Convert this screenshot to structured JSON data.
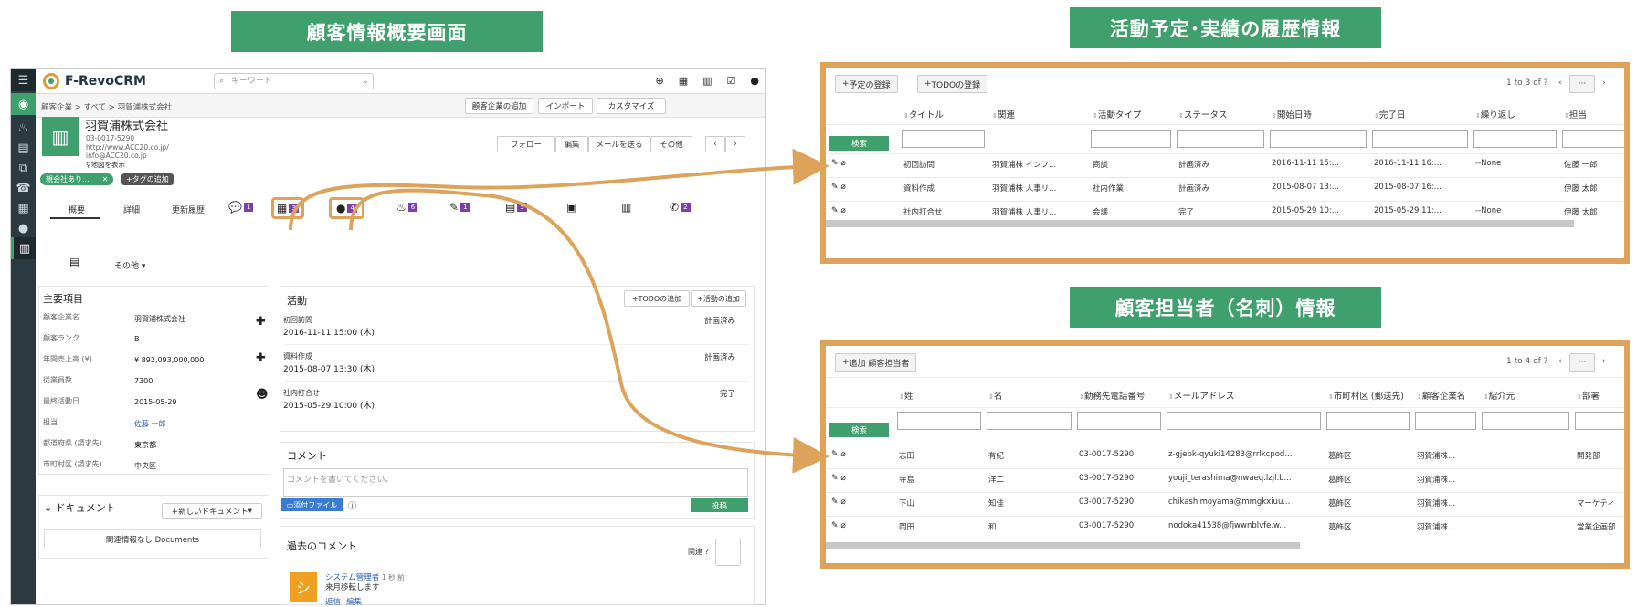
{
  "banners": {
    "overview": "顧客情報概要画面",
    "activity_history": "活動予定･実績の履歴情報",
    "contacts_info": "顧客担当者（名刺）情報"
  },
  "colors": {
    "accent_green": "#3f9f6d",
    "highlight_orange": "#dda35a",
    "badge_purple": "#7b3fb0",
    "rail_dark": "#2b3a40"
  },
  "crm": {
    "app_name": "F-RevoCRM",
    "search_placeholder": "キーワード",
    "breadcrumb": "顧客企業 > すべて > 羽賀浦株式会社",
    "header_buttons": [
      "顧客企業の追加",
      "インポート",
      "カスタマイズ"
    ],
    "record": {
      "name": "羽賀浦株式会社",
      "phone": "03-0017-5290",
      "website": "http://www.ACC20.co.jp/",
      "email": "info@ACC20.co.jp",
      "map_link": "地図を表示",
      "tag": "親会社あり...",
      "add_tag": "+タグの追加"
    },
    "action_buttons": {
      "follow": "フォロー",
      "edit": "編集",
      "send_mail": "メールを送る",
      "more": "その他",
      "prev": "‹",
      "next": "›"
    },
    "tabs": {
      "summary": "概要",
      "detail": "詳細",
      "history": "更新履歴",
      "other": "その他"
    },
    "tab_counts": {
      "comments": "1",
      "events": "3",
      "contacts": "4",
      "t4": "6",
      "t5": "1",
      "t6": "5",
      "t7": "2"
    },
    "main_fields": {
      "title": "主要項目",
      "items": [
        {
          "label": "顧客企業名",
          "value": "羽賀浦株式会社"
        },
        {
          "label": "顧客ランク",
          "value": "B"
        },
        {
          "label": "年間売上高 (¥)",
          "value": "¥ 892,093,000,000"
        },
        {
          "label": "従業員数",
          "value": "7300"
        },
        {
          "label": "最終活動日",
          "value": "2015-05-29"
        },
        {
          "label": "担当",
          "value": "佐藤 一郎"
        },
        {
          "label": "都道府県 (請求先)",
          "value": "東京都"
        },
        {
          "label": "市町村区 (請求先)",
          "value": "中央区"
        }
      ]
    },
    "activities": {
      "title": "活動",
      "add_todo": "TODOの追加",
      "add_activity": "活動の追加",
      "items": [
        {
          "title": "初回訪問",
          "date": "2016-11-11 15:00 (木)",
          "status": "計画済み"
        },
        {
          "title": "資料作成",
          "date": "2015-08-07 13:30 (木)",
          "status": "計画済み"
        },
        {
          "title": "社内打合せ",
          "date": "2015-05-29 10:00 (木)",
          "status": "完了"
        }
      ]
    },
    "documents": {
      "title": "ドキュメント",
      "new_button": "+新しいドキュメント",
      "empty": "関連情報なし Documents"
    },
    "comments": {
      "title": "コメント",
      "placeholder": "コメントを書いてください。",
      "attach": "添付ファイル",
      "post": "投稿",
      "past_title": "過去のコメント",
      "related_label": "関連",
      "author": "システム管理者",
      "time": "1 秒 前",
      "body": "来月移転します",
      "reply": "返信",
      "edit": "編集"
    }
  },
  "activity_panel": {
    "buttons": [
      "予定の登録",
      "TODOの登録"
    ],
    "pagination": "1 to 3  of ?",
    "more": "···",
    "search_button": "検索",
    "headers": [
      "タイトル",
      "関連",
      "活動タイプ",
      "ステータス",
      "開始日時",
      "完了日",
      "繰り返し",
      "担当"
    ],
    "rows": [
      [
        "初回訪問",
        "羽賀浦株  インフ...",
        "商談",
        "計画済み",
        "2016-11-11 15:...",
        "2016-11-11 16:...",
        "--None",
        "佐藤 一郎"
      ],
      [
        "資料作成",
        "羽賀浦株  人事リ...",
        "社内作業",
        "計画済み",
        "2015-08-07 13:...",
        "2015-08-07 16:...",
        "",
        "伊藤 太郎"
      ],
      [
        "社内打合せ",
        "羽賀浦株  人事リ...",
        "会議",
        "完了",
        "2015-05-29 10:...",
        "2015-05-29 11:...",
        "--None",
        "伊藤 太郎"
      ]
    ]
  },
  "contacts_panel": {
    "buttons": [
      "追加 顧客担当者"
    ],
    "pagination": "1 to 4  of ?",
    "more": "···",
    "search_button": "検索",
    "headers": [
      "姓",
      "名",
      "勤務先電話番号",
      "メールアドレス",
      "市町村区 (郵送先)",
      "顧客企業名",
      "紹介元",
      "部署"
    ],
    "rows": [
      [
        "志田",
        "有紀",
        "03-0017-5290",
        "z-gjebk-qyuki14283@rrlkcpod...",
        "葛飾区",
        "羽賀浦株...",
        "",
        "開発部"
      ],
      [
        "寺島",
        "洋二",
        "03-0017-5290",
        "youji_terashima@nwaeq.lzjl.b...",
        "葛飾区",
        "羽賀浦株...",
        "",
        ""
      ],
      [
        "下山",
        "知佳",
        "03-0017-5290",
        "chikashimoyama@mmgkxiuu...",
        "葛飾区",
        "羽賀浦株...",
        "",
        "マーケティ"
      ],
      [
        "岡田",
        "和",
        "03-0017-5290",
        "nodoka41538@fjwwnblvfe.w...",
        "葛飾区",
        "羽賀浦株...",
        "",
        "営業企画部"
      ]
    ]
  }
}
